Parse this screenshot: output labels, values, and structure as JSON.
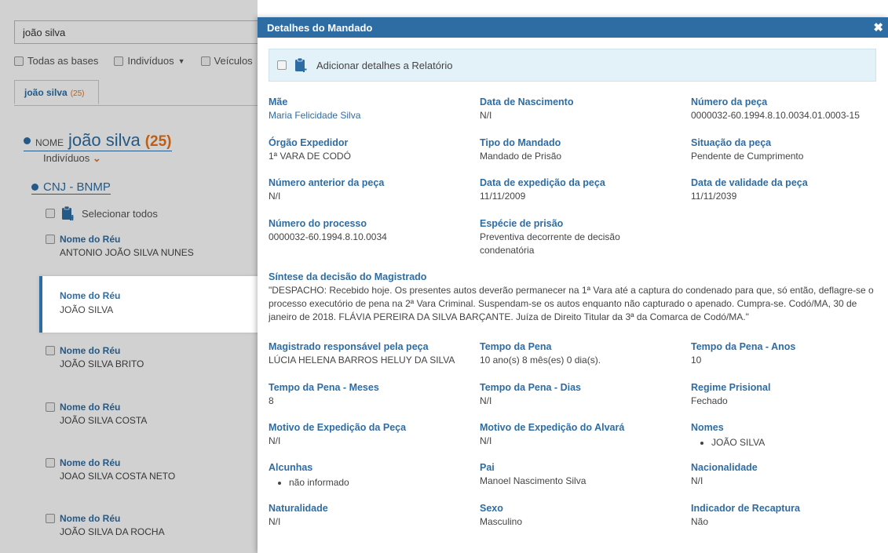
{
  "search": {
    "value": "joão silva"
  },
  "filters": {
    "all_bases": "Todas as bases",
    "individuals": "Indivíduos",
    "vehicles": "Veículos"
  },
  "tab": {
    "label": "joão silva",
    "count": "(25)"
  },
  "group": {
    "label": "NOME",
    "name": "joão silva",
    "count": "(25)",
    "sub": "Indivíduos"
  },
  "source": {
    "name": "CNJ - BNMP",
    "select_all": "Selecionar todos"
  },
  "results": [
    {
      "key": "Nome do Réu",
      "value": "ANTONIO JOÃO SILVA NUNES"
    },
    {
      "key": "Nome do Réu",
      "value": "JOÃO SILVA"
    },
    {
      "key": "Nome do Réu",
      "value": "JOÃO SILVA BRITO"
    },
    {
      "key": "Nome do Réu",
      "value": "JOÃO SILVA COSTA"
    },
    {
      "key": "Nome do Réu",
      "value": "JOAO SILVA COSTA NETO"
    },
    {
      "key": "Nome do Réu",
      "value": "JOÃO SILVA DA ROCHA"
    }
  ],
  "modal": {
    "title": "Detalhes do Mandado",
    "close": "✖",
    "add_report": "Adicionar detalhes a Relatório",
    "fields": [
      {
        "k": "Mãe",
        "v": "Maria Felicidade Silva"
      },
      {
        "k": "Data de Nascimento",
        "v": "N/I"
      },
      {
        "k": "Número da peça",
        "v": "0000032-60.1994.8.10.0034.01.0003-15"
      },
      {
        "k": "Órgão Expedidor",
        "v": "1ª VARA DE CODÓ"
      },
      {
        "k": "Tipo do Mandado",
        "v": "Mandado de Prisão"
      },
      {
        "k": "Situação da peça",
        "v": "Pendente de Cumprimento"
      },
      {
        "k": "Número anterior da peça",
        "v": "N/I"
      },
      {
        "k": "Data de expedição da peça",
        "v": "11/11/2009"
      },
      {
        "k": "Data de validade da peça",
        "v": "11/11/2039"
      },
      {
        "k": "Número do processo",
        "v": "0000032-60.1994.8.10.0034"
      },
      {
        "k": "Espécie de prisão",
        "v": "Preventiva decorrente de decisão condenatória"
      },
      {
        "k": "Magistrado responsável pela peça",
        "v": "LÚCIA HELENA BARROS HELUY DA SILVA"
      },
      {
        "k": "Tempo da Pena",
        "v": "10 ano(s) 8 mês(es) 0 dia(s)."
      },
      {
        "k": "Tempo da Pena - Anos",
        "v": "10"
      },
      {
        "k": "Tempo da Pena - Meses",
        "v": "8"
      },
      {
        "k": "Tempo da Pena - Dias",
        "v": "N/I"
      },
      {
        "k": "Regime Prisional",
        "v": "Fechado"
      },
      {
        "k": "Motivo de Expedição da Peça",
        "v": "N/I"
      },
      {
        "k": "Motivo de Expedição do Alvará",
        "v": "N/I"
      },
      {
        "k": "Nomes",
        "v": "JOÃO SILVA"
      },
      {
        "k": "Alcunhas",
        "v": "não informado"
      },
      {
        "k": "Pai",
        "v": "Manoel Nascimento Silva"
      },
      {
        "k": "Nacionalidade",
        "v": "N/I"
      },
      {
        "k": "Naturalidade",
        "v": "N/I"
      },
      {
        "k": "Sexo",
        "v": "Masculino"
      },
      {
        "k": "Indicador de Recaptura",
        "v": "Não"
      }
    ],
    "synthesis": {
      "k": "Síntese da decisão do Magistrado",
      "v": "\"DESPACHO: Recebido hoje. Os presentes autos deverão permanecer na 1ª Vara até a captura do condenado para que, só então, deflagre-se o processo executório de pena na 2ª Vara Criminal. Suspendam-se os autos enquanto não capturado o apenado. Cumpra-se. Codó/MA, 30 de janeiro de 2018. FLÁVIA PEREIRA DA SILVA BARÇANTE. Juíza de Direito Titular da 3ª da Comarca de Codó/MA.\""
    }
  }
}
